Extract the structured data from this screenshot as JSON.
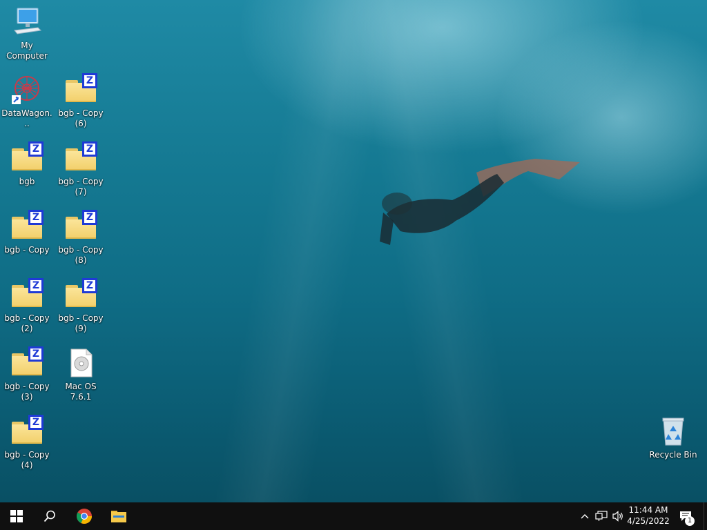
{
  "desktop": {
    "icons": [
      {
        "label": "My Computer",
        "sub": ""
      },
      {
        "label": "DataWagon...",
        "sub": ""
      },
      {
        "label": "bgb",
        "sub": ""
      },
      {
        "label": "bgb - Copy",
        "sub": ""
      },
      {
        "label": "bgb - Copy",
        "sub": "(2)"
      },
      {
        "label": "bgb - Copy",
        "sub": "(3)"
      },
      {
        "label": "bgb - Copy",
        "sub": "(4)"
      },
      {
        "label": "bgb - Copy",
        "sub": "(6)"
      },
      {
        "label": "bgb - Copy",
        "sub": "(7)"
      },
      {
        "label": "bgb - Copy",
        "sub": "(8)"
      },
      {
        "label": "bgb - Copy",
        "sub": "(9)"
      },
      {
        "label": "Mac OS 7.6.1",
        "sub": ""
      },
      {
        "label": "Recycle Bin",
        "sub": ""
      }
    ],
    "badge_letter": "Z"
  },
  "taskbar": {
    "time": "11:44 AM",
    "date": "4/25/2022",
    "notification_count": "1",
    "icons": [
      "windows-start-icon",
      "search-icon",
      "chrome-icon",
      "file-explorer-icon"
    ],
    "tray_icons": [
      "chevron-up-icon",
      "network-icon",
      "volume-icon",
      "action-center-icon"
    ]
  },
  "colors": {
    "badge_blue": "#1f3ad6",
    "folder_yellow": "#f2cf6a",
    "taskbar": "#101010"
  }
}
